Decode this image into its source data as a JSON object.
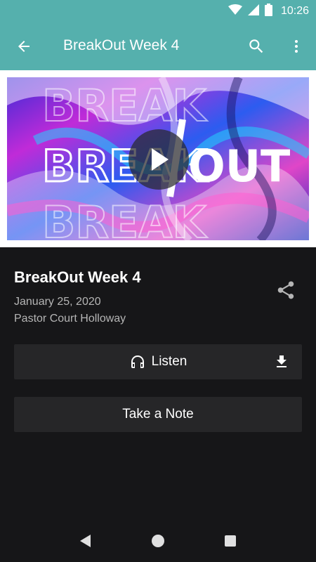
{
  "status_bar": {
    "time": "10:26",
    "icons": [
      "wifi-icon",
      "cell-signal-icon",
      "battery-icon"
    ]
  },
  "app_bar": {
    "title": "BreakOut Week 4",
    "back_icon": "arrow-back-icon",
    "search_icon": "search-icon",
    "more_icon": "more-vert-icon",
    "background_color": "#55b0ad"
  },
  "hero": {
    "artwork_text": "BREAKOUT",
    "play_icon": "play-icon"
  },
  "sermon": {
    "title": "BreakOut Week 4",
    "date": "January 25, 2020",
    "speaker": "Pastor Court Holloway",
    "share_icon": "share-icon"
  },
  "actions": {
    "listen_label": "Listen",
    "listen_icon": "headphones-icon",
    "download_icon": "download-icon",
    "note_label": "Take a Note"
  },
  "nav_bar": {
    "icons": [
      "nav-back-icon",
      "nav-home-icon",
      "nav-recents-icon"
    ]
  }
}
